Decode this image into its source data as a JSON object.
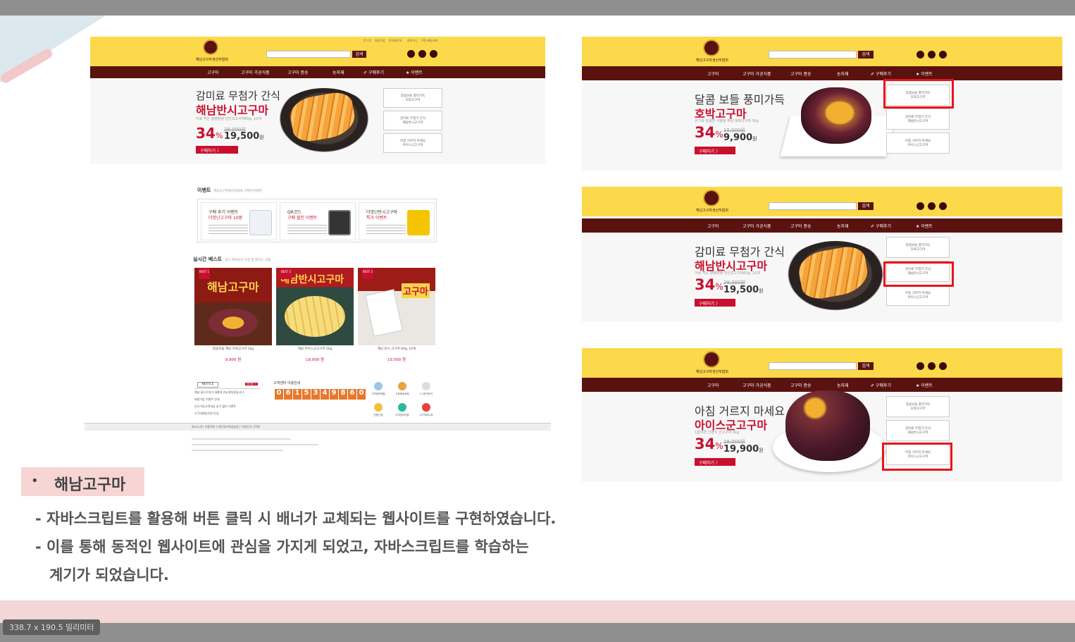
{
  "statusbar": "338.7 x 190.5 밀리미터",
  "site": {
    "logo_caption": "해남고구마생산자협회",
    "search_button": "검색",
    "top_links": [
      "로그인",
      "회원가입",
      "마이페이지",
      "장바구니",
      "주문·배송조회"
    ],
    "nav": [
      "고구마",
      "고구마 가공식품",
      "고구마 종송",
      "농자재",
      "✐ 구매후기",
      "★ 이벤트"
    ],
    "banner": {
      "title": "감미료 무첨가 간식",
      "product": "해남반시고구마",
      "sub": "이로 먹는 말랭말랭 반건조고구마60g, 10개",
      "discount": "34",
      "pct": "%",
      "old_price": "29,000원",
      "price": "19,500",
      "won": "원",
      "buy": "구매하기  〉"
    },
    "side_boxes": [
      {
        "line1": "달콤보들 풍미가득",
        "line2": "호박고구마"
      },
      {
        "line1": "감미료 무첨가 간식",
        "line2": "해남반시고구마"
      },
      {
        "line1": "아침 거르지 마세요",
        "line2": "아이스군고구마"
      }
    ],
    "event_title": "이벤트",
    "event_sub": "해남고구마생산자협회 기획전/이벤트",
    "events": [
      {
        "title": "구매 후기 이벤트",
        "sub": "더맛난고구마 10봉"
      },
      {
        "title": "QR코드",
        "sub": "구매 할인 이벤트"
      },
      {
        "title": "더맛난반시고구마",
        "sub": "특가 이벤트"
      }
    ],
    "best_title": "실시간 베스트",
    "best_sub": "최근 하루동안 가장 잘 팔리는 상품",
    "products": [
      {
        "badge": "BEST 1",
        "img_text": "해남고구마",
        "name": "달콤보들 해남 호박고구마 3kg",
        "price": "9,900 원"
      },
      {
        "badge": "BEST 2",
        "img_text": "해남반시고구마",
        "name": "해남 아이스군고구마 3kg",
        "price": "19,000 원"
      },
      {
        "badge": "BEST 3",
        "img_text": "고구마",
        "name": "해남 반시 고구마 60g, 10개",
        "price": "19,500 원"
      }
    ],
    "notice_tab": "NOTICE",
    "notice_more": "MORE +",
    "notices": [
      "해남 꿀고구마가 새롭게 리뉴얼되었습니다.",
      "회원가입 이벤트 안내",
      "신규가입고객대상 추가 할인 이벤트",
      "고구마배송지연 안내"
    ],
    "call_title": "고객센터 이용안내",
    "call_digits": [
      "0",
      "6",
      "1",
      "5",
      "3",
      "4",
      "9",
      "8",
      "6",
      "0"
    ],
    "services": [
      "가까운판매점",
      "주문배송조회",
      "1:1문의하기",
      "반품신청",
      "고객센터이용",
      "고구마레시피"
    ],
    "footer": "회사소개 | 이용약관 | 개인정보취급방침 | 이용안내 | FAQ"
  },
  "banners": [
    {
      "title": "달콤 보들 풍미가득",
      "product": "호박고구마",
      "sub": "온가족 달콤한 사랑을 해남 호박고구마 3kg",
      "discount": "34",
      "pct": "%",
      "old_price": "15,000원",
      "price": "9,900",
      "won": "원",
      "buy": "구매하기  〉"
    },
    {
      "title": "감미료 무첨가 간식",
      "product": "해남반시고구마",
      "sub": "이로 먹는 말랭말랭 반건조고구마60g, 10개",
      "discount": "34",
      "pct": "%",
      "old_price": "29,000원",
      "price": "19,500",
      "won": "원",
      "buy": "구매하기  〉"
    },
    {
      "title": "아침 거르지 마세요",
      "product": "아이스군고구마",
      "sub": "1분이면 간편식 군고구마 2kg",
      "discount": "34",
      "pct": "%",
      "old_price": "28,000원",
      "price": "19,900",
      "won": "원",
      "buy": "구매하기  〉"
    }
  ],
  "caption": {
    "bullet": "•",
    "title": "해남고구마",
    "line1": "- 자바스크립트를 활용해 버튼 클릭 시 배너가 교체되는 웹사이트를 구현하였습니다.",
    "line2": "- 이를 통해 동적인 웹사이트에 관심을 가지게 되었고, 자바스크립트를 학습하는",
    "line3": "계기가 되었습니다."
  },
  "colors": {
    "yellow": "#fcd94a",
    "maroon": "#5a120f",
    "red": "#c8102e",
    "highlight": "#e8141c"
  }
}
